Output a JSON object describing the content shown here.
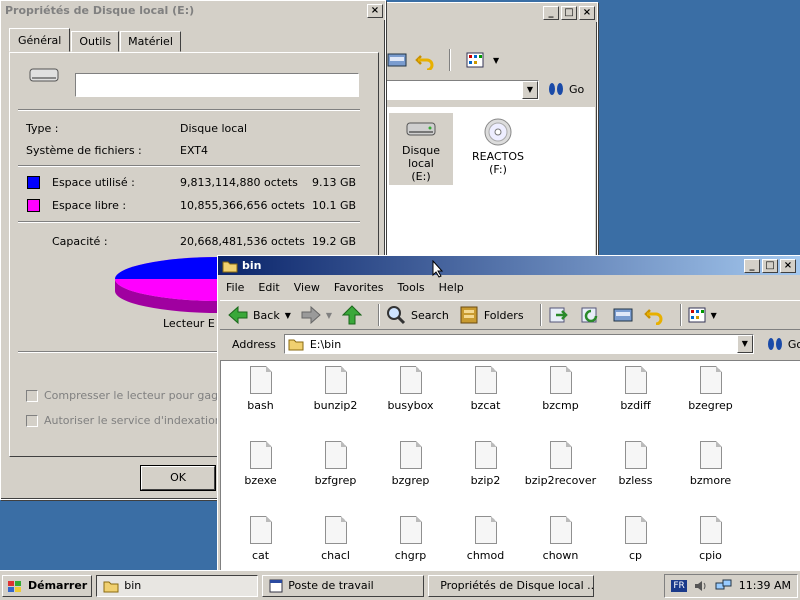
{
  "mypc": {
    "go_label": "Go",
    "drives": [
      {
        "label": "Disque local\n(E:)"
      },
      {
        "label": "REACTOS\n(F:)"
      }
    ]
  },
  "props": {
    "title": "Propriétés de Disque local (E:)",
    "tabs": [
      "Général",
      "Outils",
      "Matériel"
    ],
    "name_value": "",
    "type_label": "Type :",
    "type_value": "Disque local",
    "fs_label": "Système de fichiers :",
    "fs_value": "EXT4",
    "used_label": "Espace utilisé :",
    "used_bytes": "9,813,114,880 octets",
    "used_size": "9.13 GB",
    "free_label": "Espace libre :",
    "free_bytes": "10,855,366,656 octets",
    "free_size": "10.1 GB",
    "cap_label": "Capacité :",
    "cap_bytes": "20,668,481,536 octets",
    "cap_size": "19.2 GB",
    "drive_caption": "Lecteur E",
    "compress_label": "Compresser le lecteur pour gagner d",
    "index_label": "Autoriser le service d'indexation à in",
    "ok_label": "OK",
    "colors": {
      "used": "#0000ff",
      "free": "#ff00ff"
    }
  },
  "bin": {
    "title": "bin",
    "menu": [
      "File",
      "Edit",
      "View",
      "Favorites",
      "Tools",
      "Help"
    ],
    "back_label": "Back",
    "search_label": "Search",
    "folders_label": "Folders",
    "address_label": "Address",
    "address_value": "E:\\bin",
    "go_label": "Go",
    "files": [
      "bash",
      "bunzip2",
      "busybox",
      "bzcat",
      "bzcmp",
      "bzdiff",
      "bzegrep",
      "bzexe",
      "bzfgrep",
      "bzgrep",
      "bzip2",
      "bzip2recover",
      "bzless",
      "bzmore",
      "cat",
      "chacl",
      "chgrp",
      "chmod",
      "chown",
      "cp",
      "cpio"
    ]
  },
  "taskbar": {
    "start_label": "Démarrer",
    "tasks": [
      "bin",
      "Poste de travail",
      "Propriétés de Disque local ..."
    ],
    "lang": "FR",
    "clock": "11:39 AM"
  }
}
